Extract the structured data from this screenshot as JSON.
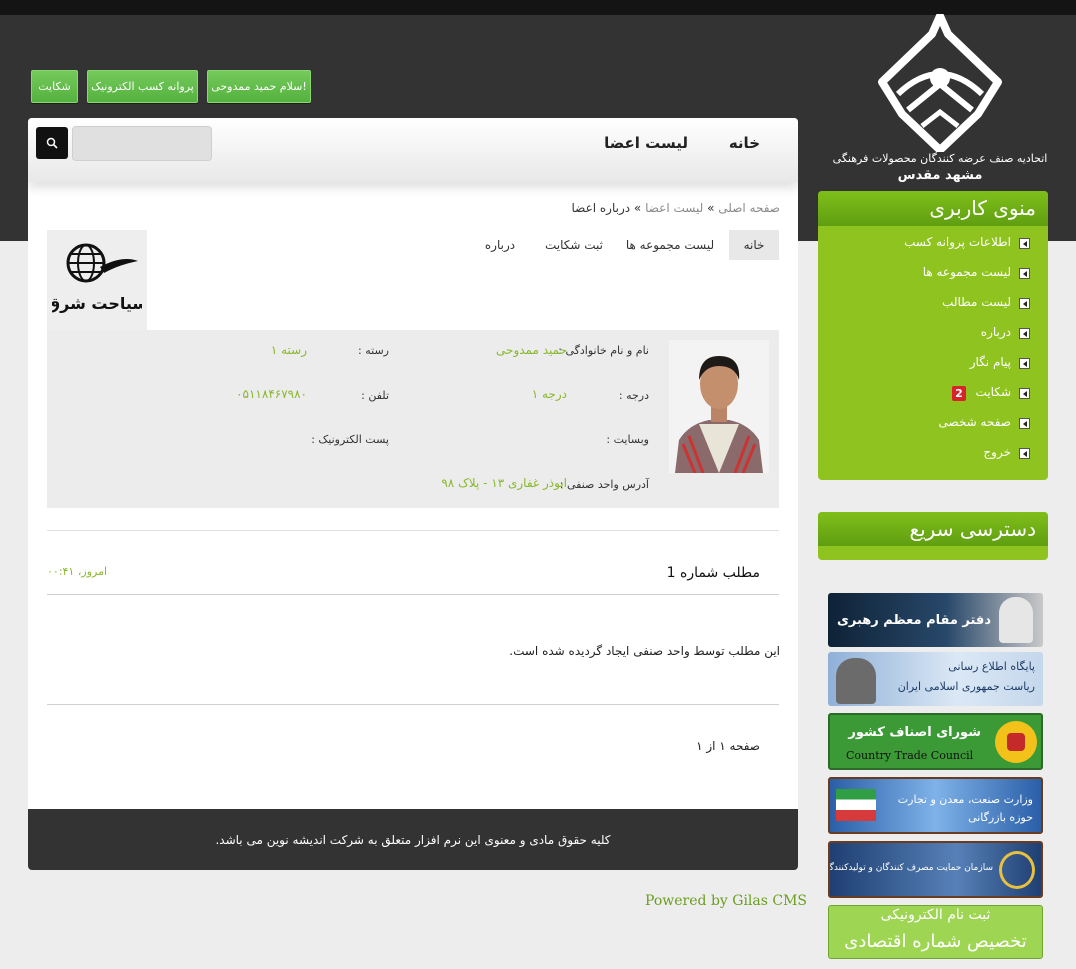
{
  "header": {
    "org_line1": "اتحادیه صنف عرضه کنندگان محصولات فرهنگی",
    "org_line2": "مشهد مقدس",
    "buttons": {
      "greeting": "سلام حمید ممدوحی!",
      "license": "پروانه کسب الکترونیک",
      "complaint": "شکایت"
    }
  },
  "nav": {
    "home": "خانه",
    "members": "لیست اعضا",
    "search_placeholder": ""
  },
  "breadcrumb": {
    "home": "صفحه اصلی",
    "sep": "»",
    "members": "لیست اعضا",
    "current": "درباره اعضا"
  },
  "tabs": {
    "home": "خانه",
    "collections": "لیست مجموعه ها",
    "complaint": "ثبت شکایت",
    "about": "درباره"
  },
  "partner": {
    "logo_text": "سیاحت شرق"
  },
  "profile": {
    "name_label": "نام و نام خانوادگی :",
    "name_value": "حمید ممدوحی",
    "category_label": "رسته :",
    "category_value": "رسته ۱",
    "grade_label": "درجه :",
    "grade_value": "درجه ۱",
    "phone_label": "تلفن :",
    "phone_value": "۰۵۱۱۸۴۶۷۹۸۰",
    "website_label": "وبسایت :",
    "email_label": "پست الکترونیک :",
    "address_label": "آدرس واحد صنفی :",
    "address_value": "ابوذر غفاری ۱۳ - پلاک ۹۸"
  },
  "post": {
    "title": "مطلب شماره 1",
    "date": "امروز، ۰۰:۴۱",
    "body": "این مطلب توسط واحد صنفی ایجاد گردیده شده است."
  },
  "pager": {
    "text": "صفحه ۱ از ۱"
  },
  "footer": {
    "copyright": "کلیه حقوق مادی و معنوی این نرم افزار متعلق به شرکت اندیشه نوین می باشد.",
    "powered": "Powered by Gilas CMS"
  },
  "sidebar": {
    "menu_title": "منوی کاربری",
    "menu_items": [
      {
        "label": "اطلاعات پروانه کسب"
      },
      {
        "label": "لیست مجموعه ها"
      },
      {
        "label": "لیست مطالب"
      },
      {
        "label": "درباره"
      },
      {
        "label": "پیام نگار"
      },
      {
        "label": "شکایت",
        "badge": "2"
      },
      {
        "label": "صفحه شخصی"
      },
      {
        "label": "خروج"
      }
    ],
    "quick_title": "دسترسی سریع",
    "banners": {
      "leader": "دفتر مقام معظم رهبری",
      "president_line1": "پایگاه اطلاع رسانی",
      "president_line2": "ریاست جمهوری اسلامی ایران",
      "trade_fa": "شورای اصناف کشور",
      "trade_en": "Country Trade Council",
      "ministry_line1": "وزارت صنعت، معدن و تجارت",
      "ministry_line2": "حوزه بازرگانی",
      "consumer": "سازمان حمایت مصرف کنندگان و تولیدکنندگان",
      "eco_line1": "ثبت نام الکترونیکی",
      "eco_line2": "تخصیص شماره اقتصادی"
    }
  }
}
